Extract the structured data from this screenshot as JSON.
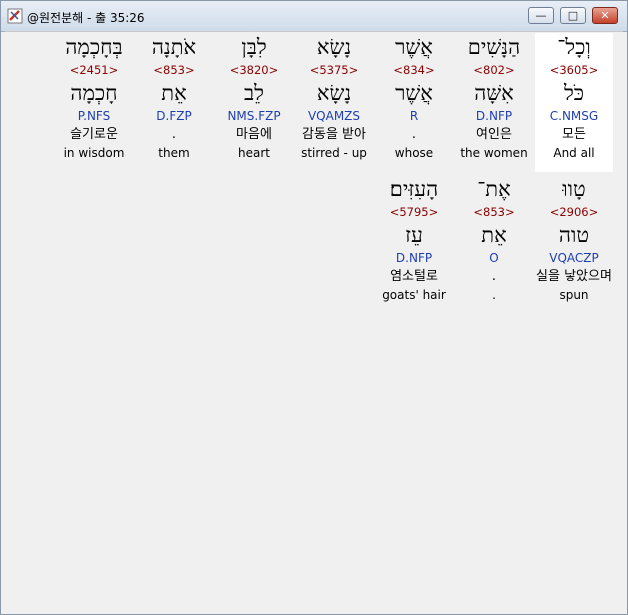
{
  "window": {
    "title": "@원전분해 - 출 35:26",
    "icon": "app-logo-icon",
    "minimize_label": "—",
    "maximize_label": "□",
    "close_label": "✕"
  },
  "lines": [
    [
      {
        "heb": "וְכָל־",
        "num": "<3605>",
        "lex": "כֹּל",
        "morph": "C.NMSG",
        "kor": "모든",
        "eng": "And all",
        "selected": true
      },
      {
        "heb": "הַנָּשִׁים",
        "num": "<802>",
        "lex": "אִשָּׁה",
        "morph": "D.NFP",
        "kor": "여인은",
        "eng": "the women"
      },
      {
        "heb": "אֲשֶׁר",
        "num": "<834>",
        "lex": "אֲשֶׁר",
        "morph": "R",
        "kor": ".",
        "eng": "whose"
      },
      {
        "heb": "נָשָׂא",
        "num": "<5375>",
        "lex": "נָשָׂא",
        "morph": "VQAMZS",
        "kor": "감동을 받아",
        "eng": "stirred - up"
      },
      {
        "heb": "לִבָּן",
        "num": "<3820>",
        "lex": "לֵב",
        "morph": "NMS.FZP",
        "kor": "마음에",
        "eng": "heart"
      },
      {
        "heb": "אֹתָנָה",
        "num": "<853>",
        "lex": "אֵת",
        "morph": "D.FZP",
        "kor": ".",
        "eng": "them"
      },
      {
        "heb": "בְּחָכְמָה",
        "num": "<2451>",
        "lex": "חָכְמָה",
        "morph": "P.NFS",
        "kor": "슬기로운",
        "eng": "in wisdom"
      }
    ],
    [
      {
        "heb": "טָווּ",
        "num": "<2906>",
        "lex": "טוה",
        "morph": "VQACZP",
        "kor": "실을 낳았으며",
        "eng": "spun"
      },
      {
        "heb": "אֶת־",
        "num": "<853>",
        "lex": "אֵת",
        "morph": "O",
        "kor": ".",
        "eng": "."
      },
      {
        "heb": "הָעִזִּים׃",
        "num": "<5795>",
        "lex": "עֵז",
        "morph": "D.NFP",
        "kor": "염소털로",
        "eng": "goats' hair"
      }
    ]
  ]
}
